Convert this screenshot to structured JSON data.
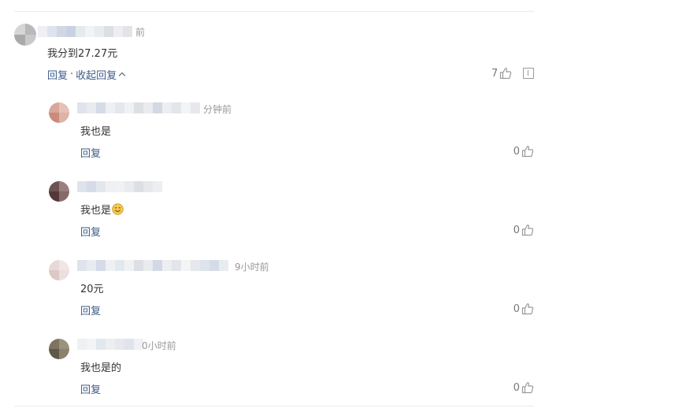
{
  "main_comment": {
    "name_tail": "前",
    "text": "我分到27.27元",
    "reply_label": "回复",
    "separator": "·",
    "collapse_label": "收起回复",
    "like_count": "7"
  },
  "replies": [
    {
      "time_tail": "分钟前",
      "text": "我也是",
      "reply_label": "回复",
      "like_count": "0"
    },
    {
      "time_tail": "",
      "text": "我也是",
      "emoji": "smile-emoji",
      "reply_label": "回复",
      "like_count": "0"
    },
    {
      "time_tail": "9小时前",
      "text": "20元",
      "reply_label": "回复",
      "like_count": "0"
    },
    {
      "time_tail": "0小时前",
      "text": "我也是的",
      "reply_label": "回复",
      "like_count": "0"
    }
  ],
  "colors": {
    "link": "#3e5b88",
    "text": "#333333",
    "muted": "#999999",
    "count": "#777777",
    "divider": "#ececec"
  },
  "icons": {
    "like": "thumbs-up-icon",
    "report": "report-icon",
    "collapse": "chevron-up-icon"
  }
}
